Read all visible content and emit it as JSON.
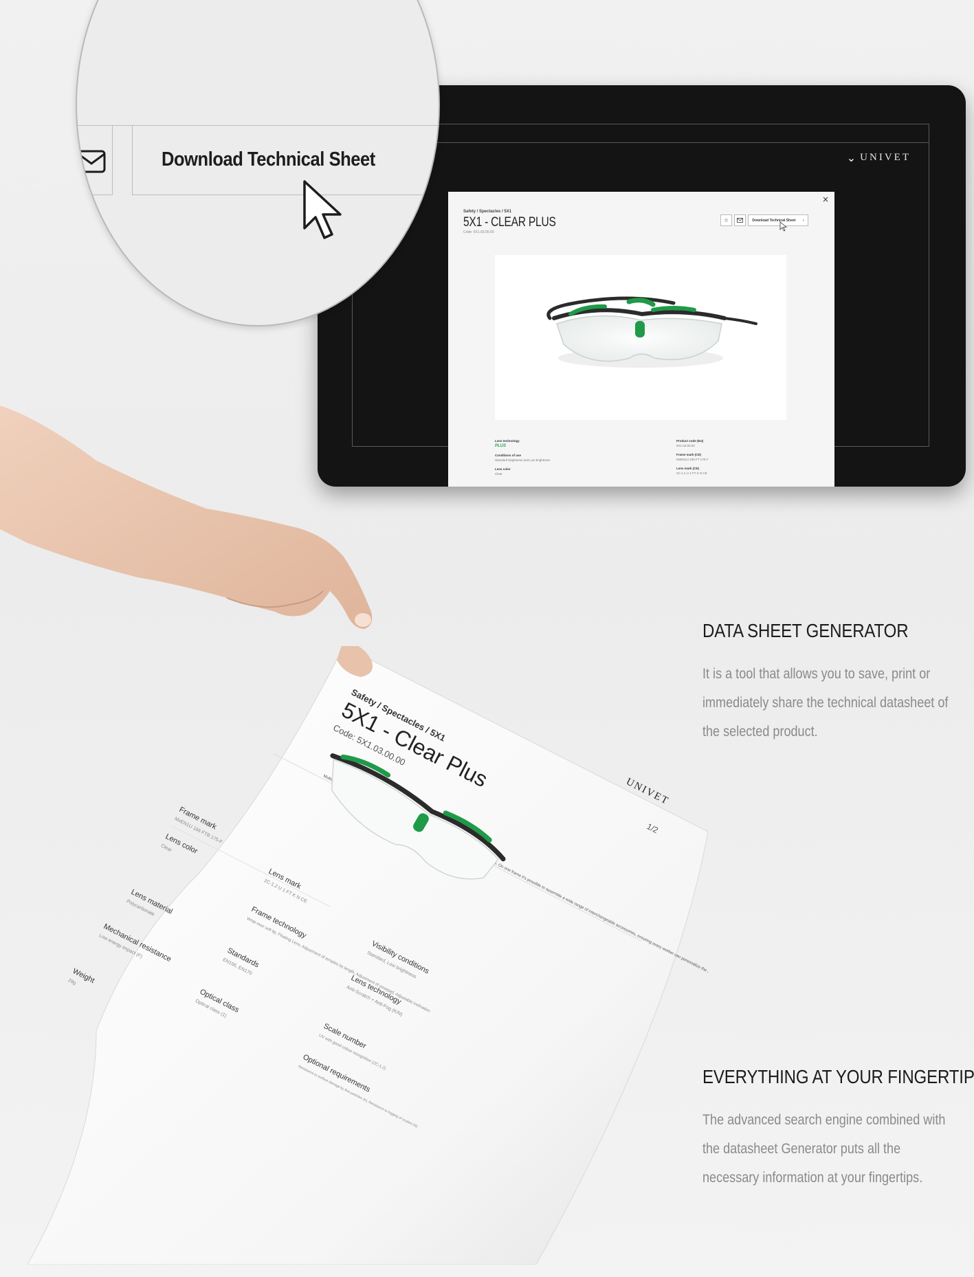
{
  "magnifier": {
    "download_label": "Download Technical Sheet"
  },
  "tablet": {
    "top_icons": "☆ ⊕",
    "brand": "UNIVET",
    "modal": {
      "close": "×",
      "breadcrumb": "Safety / Spectacles / 5X1",
      "title": "5X1 - CLEAR PLUS",
      "code": "Code: 5X1.03.00.00",
      "download_label": "Download Technical Sheet",
      "chevron": "›",
      "specs_left": [
        {
          "label": "Lens technology",
          "value": "PLUS"
        },
        {
          "label": "Conditions of use",
          "value": "Standard brightness and Low brightness"
        },
        {
          "label": "Lens color",
          "value": "Clear"
        }
      ],
      "specs_right": [
        {
          "label": "Product code (EU)",
          "value": "5X1.03.00.00"
        },
        {
          "label": "Frame mark (CE)",
          "value": "MxEN1U 166 FT 175-F"
        },
        {
          "label": "Lens mark (CE)",
          "value": "2C-1.2 U 1 FT K N CE"
        }
      ]
    }
  },
  "sheet": {
    "breadcrumb": "Safety / Spectacles / 5X1",
    "title": "5X1 - Clear Plus",
    "code": "Code: 5X1.03.00.00",
    "description": "Multifunctional and versatile, the 5X1 was created to guarantee optimal protection in any working condition. On one frame it's possible to assemble a wide range of interchangeable accessories, ensuring every worker can personalize the 5X1 without compromising comfort and protection. The extended wraparound lenses provide extra coverage around the eyes.",
    "brand": "UNIVET",
    "page": "1/2",
    "fields": [
      {
        "label": "Frame mark",
        "value": "MxEN1U 166 FTB 175-F"
      },
      {
        "label": "Lens color",
        "value": "Clear"
      },
      {
        "label": "Lens mark",
        "value": "2C-1.2 U 1 FT K N CE"
      },
      {
        "label": "Lens material",
        "value": "Polycarbonate"
      },
      {
        "label": "Frame technology",
        "value": "Wrap-over soft tip, Floating Lens, Adjustment of temples by length, Adjustment of nosepad, Adjustable inclination"
      },
      {
        "label": "Visibility conditions",
        "value": "Standard, Low brightness"
      },
      {
        "label": "Mechanical resistance",
        "value": "Low energy impact (F)"
      },
      {
        "label": "Standards",
        "value": "EN166, EN170"
      },
      {
        "label": "Lens technology",
        "value": "Anti-Scratch + Anti-Fog (K/N)"
      },
      {
        "label": "Weight",
        "value": "29g"
      },
      {
        "label": "Optical class",
        "value": "Optical class (1)"
      },
      {
        "label": "Scale number",
        "value": "UV with good colour recognition (2C-1.2)"
      },
      {
        "label": "Optional requirements",
        "value": "Resistance to surface damage by fine particles (K), Resistance to fogging of oculars (N)"
      }
    ]
  },
  "features": [
    {
      "title": "DATA SHEET GENERATOR",
      "body": "It is a tool that allows you to save, print or immediately share the technical datasheet of the selected product."
    },
    {
      "title": "EVERYTHING AT YOUR FINGERTIP",
      "body": "The advanced search engine combined with the datasheet Generator puts all the necessary information at your fingertips."
    }
  ],
  "colors": {
    "tablet_bg": "#141414",
    "accent_green": "#1f9a48",
    "text_dark": "#1b1b1b",
    "text_muted": "#8a8a8a"
  }
}
